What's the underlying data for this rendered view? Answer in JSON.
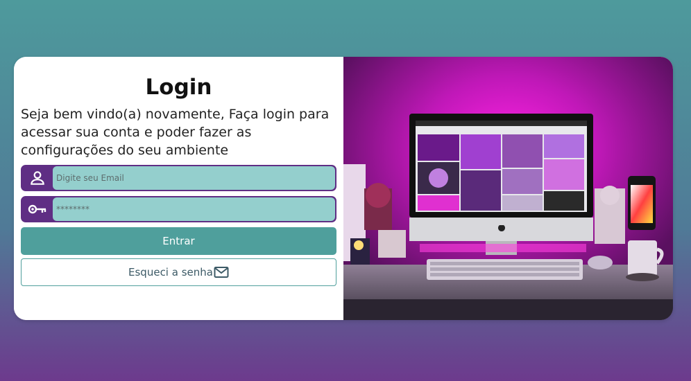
{
  "login": {
    "title": "Login",
    "description": "Seja bem vindo(a) novamente, Faça login para acessar sua conta e poder fazer as configurações do seu ambiente",
    "email_placeholder": "Digite seu Email",
    "password_placeholder": "********",
    "enter_label": "Entrar",
    "forgot_label": "Esqueci a senha"
  },
  "icons": {
    "user": "user-icon",
    "key": "key-icon",
    "mail": "mail-icon"
  },
  "colors": {
    "accent": "#4f9f9c",
    "field_border": "#5f2e84",
    "field_bg": "#94cfcd"
  }
}
